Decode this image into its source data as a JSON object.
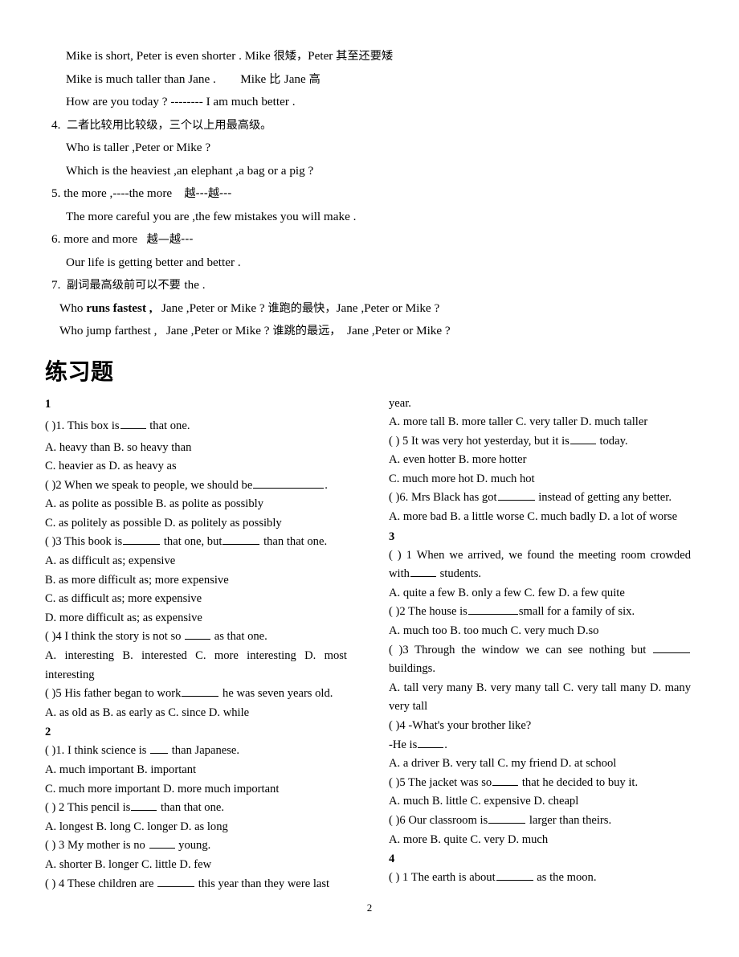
{
  "document": {
    "page_number": "2"
  },
  "notes": {
    "lines": [
      {
        "id": "n1",
        "indent": "indent",
        "text": "Mike is short, Peter is even shorter . Mike ",
        "cjk": "很矮，",
        "text2": "Peter ",
        "cjk2": "其至还要矮"
      },
      {
        "id": "n2",
        "indent": "indent",
        "text": "Mike is much taller than Jane .        Mike ",
        "cjk": "比 ",
        "text2": "Jane ",
        "cjk2": "高"
      },
      {
        "id": "n3",
        "indent": "indent",
        "text": "How are you today ? -------- I am much better ."
      },
      {
        "id": "n4",
        "indent": "numbered",
        "text": "4.  ",
        "cjk": "二者比较用比较级，三个以上用最高级。"
      },
      {
        "id": "n5",
        "indent": "indent",
        "text": "Who is taller ,Peter or Mike ?"
      },
      {
        "id": "n6",
        "indent": "indent",
        "text": "Which is the heaviest ,an elephant ,a bag or a pig ?"
      },
      {
        "id": "n7",
        "indent": "numbered",
        "text": "5. the more ,----the more    ",
        "cjk": "越---越---"
      },
      {
        "id": "n8",
        "indent": "indent",
        "text": "The more careful you are ,the few mistakes you will make ."
      },
      {
        "id": "n9",
        "indent": "numbered",
        "text": "6. more and more   ",
        "cjk": "越—越---"
      },
      {
        "id": "n10",
        "indent": "indent",
        "text": "Our life is getting better and better ."
      },
      {
        "id": "n11",
        "indent": "numbered",
        "text": "7.  ",
        "cjk": "副词最高级前可以不要 ",
        "text2": "the ."
      }
    ],
    "adverb_examples": [
      {
        "id": "a1",
        "pre": "Who ",
        "bold": "runs fastest ,",
        "mid": "   Jane ,Peter or Mike ? ",
        "cjk": "谁跑的最快，",
        "post": "Jane ,Peter or Mike ?"
      },
      {
        "id": "a2",
        "pre": "Who jump farthest ,",
        "bold": "",
        "mid": "   Jane ,Peter or Mike ? ",
        "cjk": "谁跳的最远，",
        "post": "  Jane ,Peter or Mike ?"
      }
    ]
  },
  "exercises": {
    "heading": "练习题",
    "left_column": [
      {
        "type": "group",
        "text": "1"
      },
      {
        "type": "q",
        "before": "( )1. This box is",
        "blank": "b-md",
        "after": " that one.",
        "spaced": true
      },
      {
        "type": "opt",
        "text": "A. heavy than B. so heavy than"
      },
      {
        "type": "opt",
        "text": "C. heavier as D. as heavy as"
      },
      {
        "type": "q",
        "before": "( )2 When we speak to people, we should be",
        "blank": "b-xxl",
        "after": "."
      },
      {
        "type": "opt",
        "text": "A. as polite as possible B. as polite as possibly"
      },
      {
        "type": "opt",
        "text": "C. as politely as possible D. as politely as possibly"
      },
      {
        "type": "q2",
        "before": "( )3 This book is",
        "blank": "b-lg",
        "mid": " that one, but",
        "blank2": "b-lg",
        "after": " than that one."
      },
      {
        "type": "opt",
        "text": "A. as difficult as; expensive"
      },
      {
        "type": "opt",
        "text": "B. as more difficult as; more expensive"
      },
      {
        "type": "opt",
        "text": "C. as difficult as; more expensive"
      },
      {
        "type": "opt",
        "text": "D. more difficult as; as expensive"
      },
      {
        "type": "q",
        "before": "( )4 I think the story is not so ",
        "blank": "b-md",
        "after": " as that one."
      },
      {
        "type": "opt",
        "justify": true,
        "text": "A. interesting B. interested C. more interesting D. most interesting"
      },
      {
        "type": "q",
        "before": "( )5 His father began to work",
        "blank": "b-lg",
        "after": " he was seven years old."
      },
      {
        "type": "opt",
        "text": "A. as old as B. as early as C. since D. while"
      },
      {
        "type": "group",
        "text": "2"
      },
      {
        "type": "q",
        "before": "( )1. I think science is ",
        "blank": "b-sm",
        "after": " than Japanese."
      },
      {
        "type": "opt",
        "text": "A. much important B. important"
      },
      {
        "type": "opt",
        "text": "C. much more important D. more much important"
      },
      {
        "type": "q",
        "before": "( ) 2 This pencil is",
        "blank": "b-md",
        "after": " than that one."
      },
      {
        "type": "opt",
        "text": "A. longest B. long C. longer D. as long"
      },
      {
        "type": "q",
        "before": "( ) 3 My mother is no ",
        "blank": "b-md",
        "after": " young."
      },
      {
        "type": "opt",
        "text": "A. shorter B. longer C. little D. few"
      },
      {
        "type": "q",
        "before": "( ) 4 These children are ",
        "blank": "b-lg",
        "after": " this year than they were last"
      }
    ],
    "right_column": [
      {
        "type": "opt",
        "text": "year."
      },
      {
        "type": "opt",
        "text": "A. more tall B. more taller C. very taller D. much taller"
      },
      {
        "type": "q",
        "before": "( ) 5 It was very hot yesterday, but it is",
        "blank": "b-md",
        "after": " today."
      },
      {
        "type": "opt",
        "text": "A. even hotter B. more hotter"
      },
      {
        "type": "opt",
        "text": "C. much more hot D. much hot"
      },
      {
        "type": "q",
        "before": "( )6. Mrs Black has got",
        "blank": "b-lg",
        "after": " instead of getting any better."
      },
      {
        "type": "opt",
        "justify": true,
        "text": "A. more bad B. a little worse C. much badly D. a lot of worse"
      },
      {
        "type": "group",
        "text": "3"
      },
      {
        "type": "q",
        "justify": true,
        "before": "( ) 1 When we arrived, we found the meeting room crowded with",
        "blank": "b-md",
        "after": " students."
      },
      {
        "type": "opt",
        "text": "A. quite a few B. only a few C. few D. a few quite"
      },
      {
        "type": "q",
        "before": "( )2 The house is",
        "blank": "b-xl",
        "after": "small for a family of six."
      },
      {
        "type": "opt",
        "text": "A. much too B. too much C. very much D.so"
      },
      {
        "type": "q",
        "justify": true,
        "before": "( )3 Through the window we can see nothing but ",
        "blank": "b-lg",
        "after": " buildings."
      },
      {
        "type": "opt",
        "justify": true,
        "text": "A. tall very many B. very many tall C. very tall many D. many very tall"
      },
      {
        "type": "opt",
        "text": "( )4 -What's your brother like?"
      },
      {
        "type": "q",
        "before": "-He is",
        "blank": "b-md",
        "after": "."
      },
      {
        "type": "opt",
        "text": "A. a driver B. very tall C. my friend D. at school"
      },
      {
        "type": "q",
        "before": "( )5 The jacket was so",
        "blank": "b-md",
        "after": " that he decided to buy it."
      },
      {
        "type": "opt",
        "text": "A. much B. little C. expensive D. cheapl"
      },
      {
        "type": "q",
        "before": "( )6 Our classroom is",
        "blank": "b-lg",
        "after": " larger than theirs."
      },
      {
        "type": "opt",
        "text": "A. more B. quite C. very D. much"
      },
      {
        "type": "group",
        "text": "4"
      },
      {
        "type": "q",
        "before": "( ) 1 The earth is about",
        "blank": "b-lg",
        "after": " as the moon."
      }
    ]
  }
}
